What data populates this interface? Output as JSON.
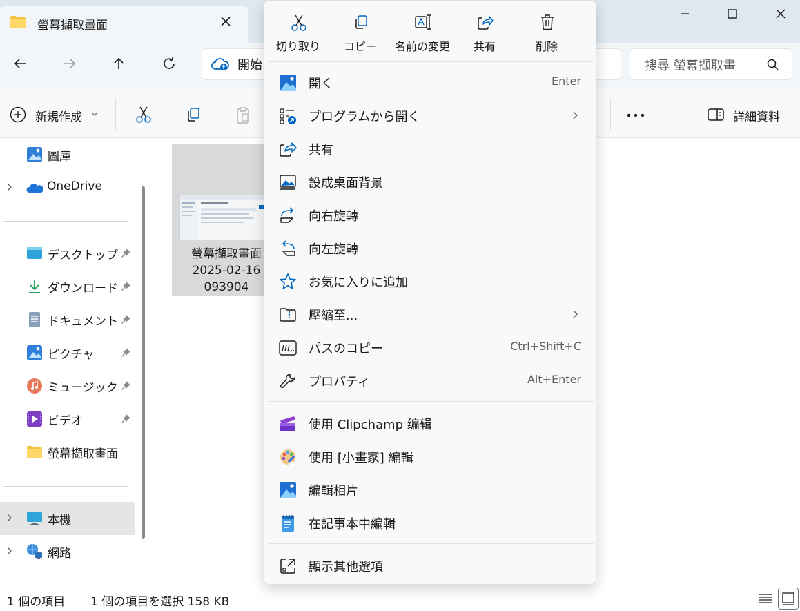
{
  "window": {
    "tab_title": "螢幕擷取畫面"
  },
  "nav": {
    "address_text": "開始",
    "search_placeholder": "搜尋 螢幕擷取畫"
  },
  "commandbar": {
    "new_label": "新規作成",
    "details_label": "詳細資料"
  },
  "sidebar": {
    "items": [
      {
        "label": "圖庫",
        "icon": "gallery-icon"
      },
      {
        "label": "OneDrive",
        "icon": "onedrive-icon"
      },
      {
        "label": "デスクトップ",
        "icon": "desktop-icon",
        "pinned": true
      },
      {
        "label": "ダウンロード",
        "icon": "download-icon",
        "pinned": true
      },
      {
        "label": "ドキュメント",
        "icon": "documents-icon",
        "pinned": true
      },
      {
        "label": "ピクチャ",
        "icon": "pictures-icon",
        "pinned": true
      },
      {
        "label": "ミュージック",
        "icon": "music-icon",
        "pinned": true
      },
      {
        "label": "ビデオ",
        "icon": "videos-icon",
        "pinned": true
      },
      {
        "label": "螢幕擷取畫面",
        "icon": "folder-icon"
      },
      {
        "label": "本機",
        "icon": "this-pc-icon"
      },
      {
        "label": "網路",
        "icon": "network-icon"
      }
    ]
  },
  "file": {
    "name_line1": "螢幕擷取畫面",
    "name_line2": "2025-02-16",
    "name_line3": "093904"
  },
  "statusbar": {
    "count": "1 個の項目",
    "selection": "1 個の項目を選択  158 KB"
  },
  "context_menu": {
    "top_actions": [
      {
        "label": "切り取り",
        "icon": "cut-icon"
      },
      {
        "label": "コピー",
        "icon": "copy-icon"
      },
      {
        "label": "名前の変更",
        "icon": "rename-icon"
      },
      {
        "label": "共有",
        "icon": "share-icon"
      },
      {
        "label": "削除",
        "icon": "delete-icon"
      }
    ],
    "items": [
      {
        "label": "開く",
        "accel": "Enter",
        "icon": "photos-icon"
      },
      {
        "label": "プログラムから開く",
        "accel": "",
        "icon": "open-with-icon",
        "submenu": true
      },
      {
        "label": "共有",
        "accel": "",
        "icon": "share-icon"
      },
      {
        "label": "設成桌面背景",
        "accel": "",
        "icon": "wallpaper-icon"
      },
      {
        "label": "向右旋轉",
        "accel": "",
        "icon": "rotate-right-icon"
      },
      {
        "label": "向左旋轉",
        "accel": "",
        "icon": "rotate-left-icon"
      },
      {
        "label": "お気に入りに追加",
        "accel": "",
        "icon": "star-icon"
      },
      {
        "label": "壓縮至...",
        "accel": "",
        "icon": "compress-icon",
        "submenu": true
      },
      {
        "label": "パスのコピー",
        "accel": "Ctrl+Shift+C",
        "icon": "copy-path-icon"
      },
      {
        "label": "プロパティ",
        "accel": "Alt+Enter",
        "icon": "wrench-icon"
      },
      {
        "label": "使用 Clipchamp 编辑",
        "accel": "",
        "icon": "clipchamp-icon"
      },
      {
        "label": "使用 [小畫家] 編輯",
        "accel": "",
        "icon": "paint-icon"
      },
      {
        "label": "編輯相片",
        "accel": "",
        "icon": "photos-icon"
      },
      {
        "label": "在記事本中編輯",
        "accel": "",
        "icon": "notepad-icon"
      },
      {
        "label": "顯示其他選項",
        "accel": "",
        "icon": "more-options-icon"
      }
    ]
  },
  "colors": {
    "accent": "#0067c0",
    "titlebar_bg": "#dfe8f1",
    "selected_tile": "#d9d9d9",
    "menu_bg": "#f9f9f9"
  }
}
